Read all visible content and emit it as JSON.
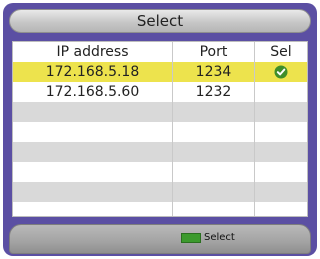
{
  "dialog": {
    "title": "Select"
  },
  "table": {
    "headers": {
      "ip": "IP address",
      "port": "Port",
      "sel": "Sel"
    },
    "rows": [
      {
        "ip": "172.168.5.18",
        "port": "1234",
        "selected": true
      },
      {
        "ip": "172.168.5.60",
        "port": "1232",
        "selected": false
      }
    ],
    "empty_rows": 6
  },
  "footer": {
    "select_label": "Select",
    "key_color": "green"
  },
  "icons": {
    "selected_marker": "check-circle-icon"
  },
  "colors": {
    "background": "#5b4fa3",
    "selected_row": "#ede34d",
    "check": "#3f8e2a",
    "green_key": "#3c9a2d"
  }
}
